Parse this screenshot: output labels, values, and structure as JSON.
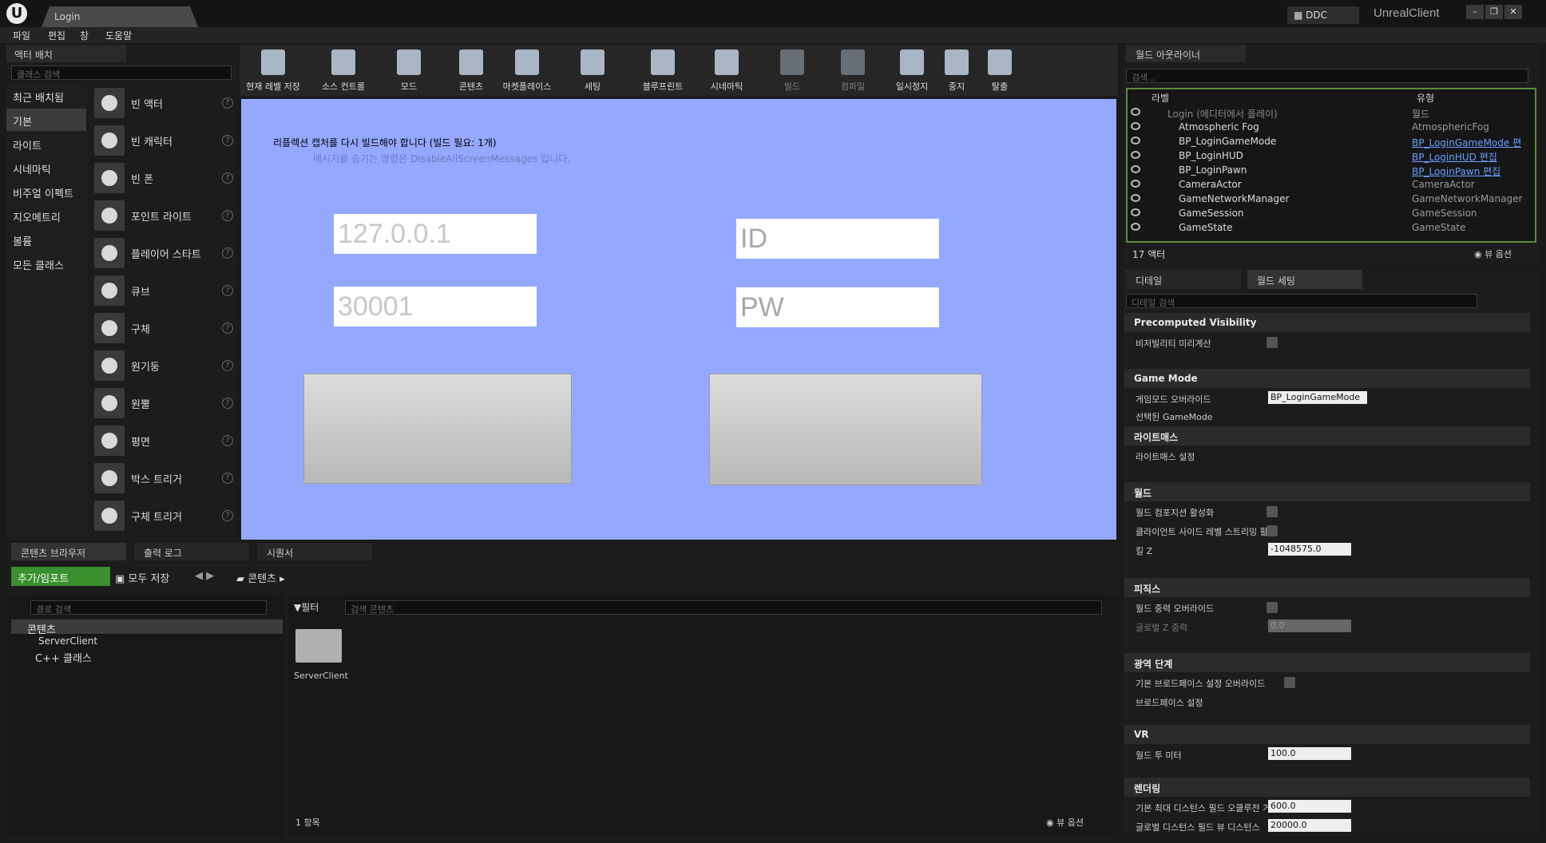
{
  "title_bar": {
    "tab": "Login",
    "ddc": "DDC",
    "app_title": "UnrealClient"
  },
  "menu": [
    "파일",
    "편집",
    "창",
    "도움말"
  ],
  "place_actors": {
    "tab": "액터 배치",
    "search_placeholder": "클래스 검색",
    "categories": [
      "최근 배치됨",
      "기본",
      "라이트",
      "시네마틱",
      "비주얼 이펙트",
      "지오메트리",
      "볼륨",
      "모든 클래스"
    ],
    "selected_category": "기본",
    "actors": [
      "빈 액터",
      "빈 캐릭터",
      "빈 폰",
      "포인트 라이트",
      "플레이어 스타트",
      "큐브",
      "구체",
      "원기둥",
      "원뿔",
      "평면",
      "박스 트리거",
      "구체 트리거"
    ]
  },
  "toolbar": [
    "현재 레벨 저장",
    "소스 컨트롤",
    "모드",
    "콘텐츠",
    "마켓플레이스",
    "세팅",
    "블루프린트",
    "시네마틱",
    "빌드",
    "컴파일",
    "일시정지",
    "중지",
    "탈출"
  ],
  "viewport": {
    "message1": "리플렉션 캡처를 다시 빌드해야 합니다 (빌드 필요: 1개)",
    "message2": "메시지를 숨기는 명령은 DisableAllScreenMessages 입니다.",
    "ip": "127.0.0.1",
    "port": "30001",
    "id_placeholder": "ID",
    "pw_placeholder": "PW"
  },
  "outliner": {
    "tab": "월드 아웃라이너",
    "search_placeholder": "검색...",
    "col_label": "라벨",
    "col_type": "유형",
    "rows": [
      {
        "name": "Login (에디터에서 플레이)",
        "type": "월드"
      },
      {
        "name": "Atmospheric Fog",
        "type": "AtmosphericFog"
      },
      {
        "name": "BP_LoginGameMode",
        "type": "BP_LoginGameMode 편"
      },
      {
        "name": "BP_LoginHUD",
        "type": "BP_LoginHUD 편집"
      },
      {
        "name": "BP_LoginPawn",
        "type": "BP_LoginPawn 편집"
      },
      {
        "name": "CameraActor",
        "type": "CameraActor"
      },
      {
        "name": "GameNetworkManager",
        "type": "GameNetworkManager"
      },
      {
        "name": "GameSession",
        "type": "GameSession"
      },
      {
        "name": "GameState",
        "type": "GameState"
      }
    ],
    "count": "17 액터",
    "view_options": "뷰 옵션"
  },
  "details": {
    "tab_details": "디테일",
    "tab_world": "월드 세팅",
    "search_placeholder": "디테일 검색",
    "sections": {
      "precomputed": "Precomputed Visibility",
      "visibility_precompute": "비저빌리티 미리계산",
      "game_mode": "Game Mode",
      "gamemode_override": "게임모드 오버라이드",
      "gamemode_value": "BP_LoginGameMode",
      "selected_gamemode": "선택된 GameMode",
      "lightmass": "라이트매스",
      "lightmass_settings": "라이트매스 설정",
      "world": "월드",
      "world_composition": "월드 컴포지션 활성화",
      "client_streaming": "클라이언트 사이드 레벨 스트리밍 활",
      "kill_z": "킬 Z",
      "kill_z_value": "-1048575.0",
      "physics": "피직스",
      "gravity_override": "월드 중력 오버라이드",
      "global_gravity": "글로벌 Z 중력",
      "global_gravity_value": "0.0",
      "broadphase": "광역 단계",
      "broadphase_override": "기본 브로드페이스 설정 오버라이드",
      "broadphase_settings": "브로드페이스 설정",
      "vr": "VR",
      "world_to_meters": "월드 투 미터",
      "world_to_meters_value": "100.0",
      "rendering": "렌더링",
      "max_distance_field": "기본 최대 디스턴스 필드 오클루전 거",
      "max_distance_field_value": "600.0",
      "global_distance_field": "글로벌 디스턴스 필드 뷰 디스턴스",
      "global_distance_field_value": "20000.0"
    }
  },
  "content_browser": {
    "tabs": [
      "콘텐츠 브라우저",
      "출력 로그",
      "시퀀서"
    ],
    "add_import": "추가/임포트",
    "save_all": "모두 저장",
    "path": "콘텐츠",
    "path_search": "경로 검색",
    "filter": "필터",
    "content_search": "검색 콘텐츠",
    "tree": [
      "콘텐츠",
      "ServerClient",
      "C++ 클래스"
    ],
    "folder": "ServerClient",
    "item_count": "1 항목",
    "view_options": "뷰 옵션"
  }
}
